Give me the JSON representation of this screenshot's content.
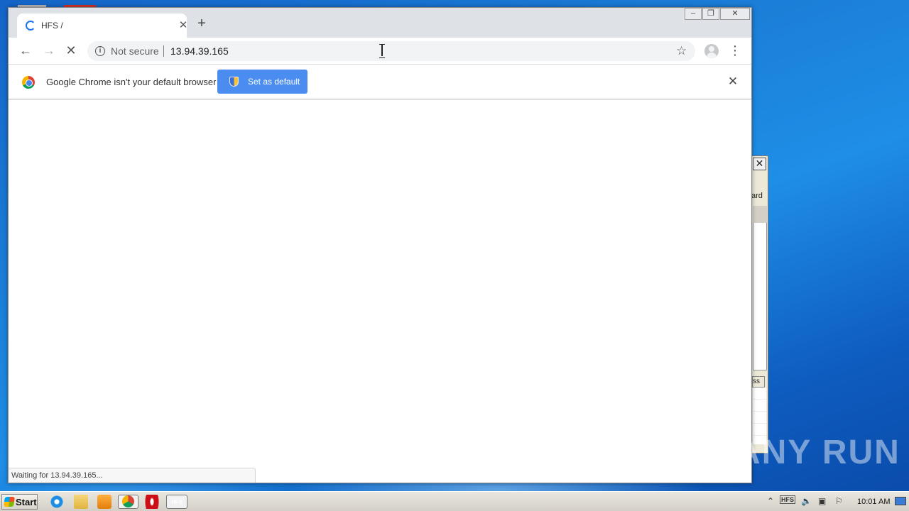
{
  "browser": {
    "tab": {
      "title": "HFS /"
    },
    "address_bar": {
      "security_label": "Not secure",
      "url": "13.94.39.165"
    },
    "infobar": {
      "message": "Google Chrome isn't your default browser",
      "button_label": "Set as default"
    },
    "status_text": "Waiting for 13.94.39.165..."
  },
  "background_window": {
    "partial_label": "ard",
    "partial_header": "ss"
  },
  "taskbar": {
    "start_label": "Start",
    "hfs_icon_label": "HFS",
    "tray_hfs_label": "HFS",
    "clock": "10:01 AM"
  },
  "watermark": "ANY RUN",
  "icons": [
    "back-arrow-icon",
    "forward-arrow-icon",
    "stop-icon",
    "info-icon",
    "star-icon",
    "profile-icon",
    "menu-icon",
    "chrome-logo-icon",
    "shield-icon",
    "close-icon",
    "plus-icon",
    "loading-spinner-icon"
  ],
  "colors": {
    "tab_bar": "#dee1e6",
    "omnibox": "#f1f3f4",
    "set_default_button": "#4a8cf0",
    "desktop": "#1b7fd8"
  }
}
